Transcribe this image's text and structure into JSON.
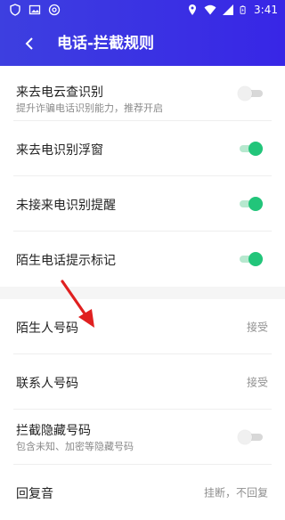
{
  "status_bar": {
    "time": "3:41",
    "icons_left": [
      "shield-icon",
      "image-icon",
      "at-sign-icon"
    ],
    "icons_right": [
      "location-icon",
      "wifi-icon",
      "signal-icon",
      "battery-icon"
    ]
  },
  "header": {
    "title": "电话-拦截规则",
    "back_icon": "chevron-left-icon",
    "gradient_start": "#3d3fe0",
    "gradient_end": "#3826e6"
  },
  "items_group1": [
    {
      "title": "来去电云查识别",
      "subtitle": "提升诈骗电话识别能力，推荐开启",
      "toggle": "off"
    },
    {
      "title": "来去电识别浮窗",
      "toggle": "on"
    },
    {
      "title": "未接来电识别提醒",
      "toggle": "on"
    },
    {
      "title": "陌生电话提示标记",
      "toggle": "on"
    }
  ],
  "items_group2": [
    {
      "title": "陌生人号码",
      "value": "接受"
    },
    {
      "title": "联系人号码",
      "value": "接受"
    },
    {
      "title": "拦截隐藏号码",
      "subtitle": "包含未知、加密等隐藏号码",
      "toggle": "off"
    },
    {
      "title": "回复音",
      "value": "挂断，不回复"
    }
  ],
  "colors": {
    "toggle_on": "#22c57a",
    "annotation_arrow": "#e02020"
  }
}
